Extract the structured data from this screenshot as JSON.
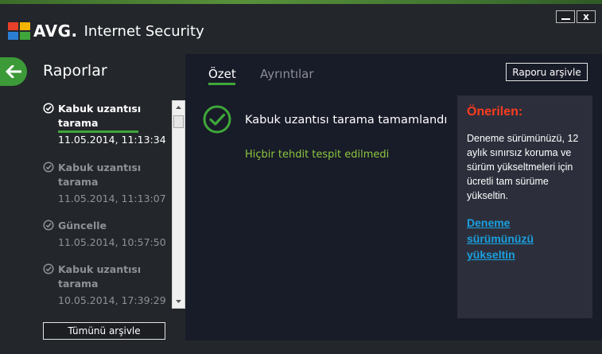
{
  "app": {
    "brand": "AVG.",
    "product": "Internet Security"
  },
  "window": {
    "minimize_label": "_",
    "close_label": "x"
  },
  "sidebar": {
    "title": "Raporlar",
    "archive_all_label": "Tümünü arşivle",
    "reports": [
      {
        "title_line1": "Kabuk uzantısı",
        "title_line2": "tarama",
        "date": "11.05.2014, 11:13:34",
        "selected": true
      },
      {
        "title_line1": "Kabuk uzantısı",
        "title_line2": "tarama",
        "date": "11.05.2014, 11:13:07",
        "selected": false
      },
      {
        "title_line1": "Güncelle",
        "title_line2": "",
        "date": "11.05.2014, 10:57:50",
        "selected": false
      },
      {
        "title_line1": "Kabuk uzantısı",
        "title_line2": "tarama",
        "date": "10.05.2014, 17:39:29",
        "selected": false
      }
    ]
  },
  "main": {
    "tabs": [
      {
        "label": "Özet",
        "active": true
      },
      {
        "label": "Ayrıntılar",
        "active": false
      }
    ],
    "archive_report_label": "Raporu arşivle",
    "result_title": "Kabuk uzantısı tarama tamamlandı",
    "result_status": "Hiçbir tehdit tespit edilmedi"
  },
  "recommendation": {
    "title": "Önerilen:",
    "text": "Deneme sürümünüzü, 12 aylık sınırsız koruma ve sürüm yükseltmeleri için ücretli tam sürüme yükseltin.",
    "link_line1": "Deneme",
    "link_line2": "sürümünüzü",
    "link_line3": "yükseltin"
  },
  "colors": {
    "accent_green": "#3fa73a",
    "status_green": "#8cc63f",
    "recommend_red": "#ff3b1f",
    "link_blue": "#1aa0e0",
    "panel_bg": "#181b28",
    "window_bg": "#23262b"
  }
}
